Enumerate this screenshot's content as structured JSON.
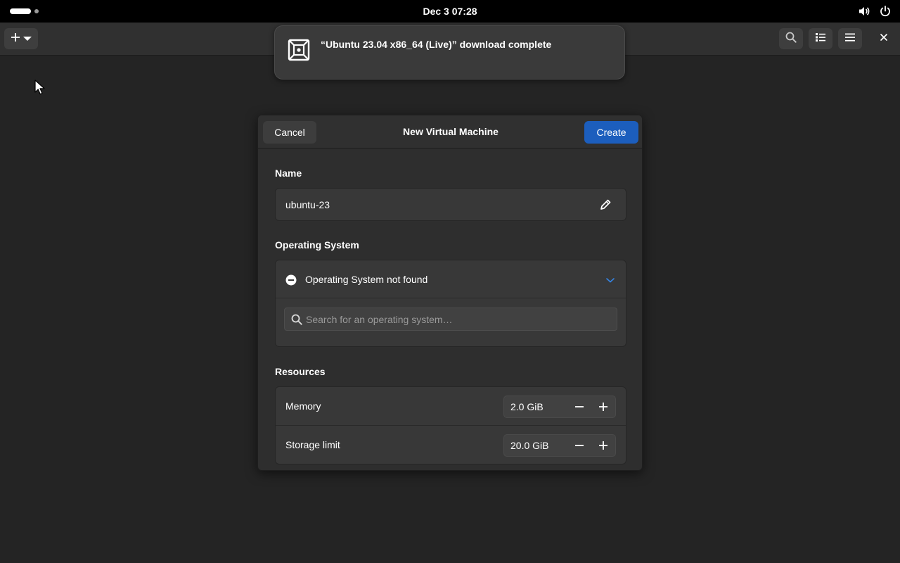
{
  "topbar": {
    "clock": "Dec 3  07:28",
    "icons": [
      "activities-indicator",
      "volume-icon",
      "power-icon"
    ]
  },
  "app_header": {
    "new_button_icons": [
      "plus-icon",
      "dropdown-arrow-icon"
    ],
    "right_buttons": [
      "search-icon",
      "list-view-icon",
      "hamburger-menu-icon",
      "close-icon"
    ]
  },
  "notification": {
    "icon": "virtual-machine-icon",
    "text": "“Ubuntu 23.04 x86_64 (Live)” download complete"
  },
  "dialog": {
    "title": "New Virtual Machine",
    "cancel_label": "Cancel",
    "create_label": "Create",
    "name_section": {
      "label": "Name",
      "value": "ubuntu-23"
    },
    "os_section": {
      "label": "Operating System",
      "status_text": "Operating System not found",
      "search_placeholder": "Search for an operating system…"
    },
    "resources_section": {
      "label": "Resources",
      "memory": {
        "label": "Memory",
        "value": "2.0 GiB"
      },
      "storage": {
        "label": "Storage limit",
        "value": "20.0 GiB"
      }
    }
  },
  "colors": {
    "background": "#242424",
    "accent": "#1c5ebd",
    "chevron": "#3584e4"
  }
}
